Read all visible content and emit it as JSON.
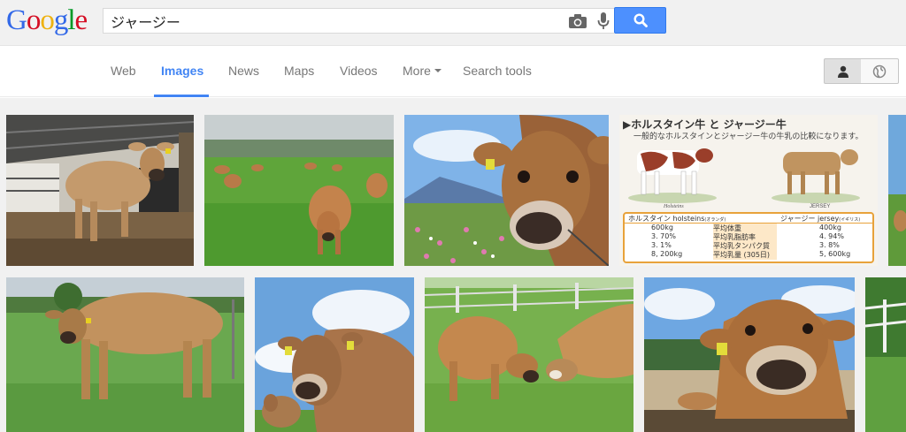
{
  "logo": {
    "letters": [
      "G",
      "o",
      "o",
      "g",
      "l",
      "e"
    ]
  },
  "search": {
    "query": "ジャージー",
    "placeholder": ""
  },
  "nav": {
    "tabs": [
      {
        "label": "Web"
      },
      {
        "label": "Images"
      },
      {
        "label": "News"
      },
      {
        "label": "Maps"
      },
      {
        "label": "Videos"
      },
      {
        "label": "More"
      },
      {
        "label": "Search tools"
      }
    ]
  },
  "icons": {
    "camera": "camera-icon",
    "mic": "microphone-icon",
    "search": "magnifier-icon",
    "person": "person-icon",
    "globe": "globe-icon"
  },
  "infographic": {
    "title": "▶ホルスタイン牛 と ジャージー牛",
    "subtitle": "一般的なホルスタインとジャージー牛の牛乳の比較になります。",
    "left_label": "Holsteins",
    "right_label": "JERSEY",
    "header_left": "ホルスタイン holsteins",
    "header_left_sub": "(オランダ)",
    "header_right": "ジャージー jersey",
    "header_right_sub": "(イギリス)",
    "rows": [
      {
        "left": "600kg",
        "metric": "平均体重",
        "right": "400kg"
      },
      {
        "left": "3. 70%",
        "metric": "平均乳脂肪率",
        "right": "4. 94%"
      },
      {
        "left": "3. 1%",
        "metric": "平均乳タンパク質",
        "right": "3. 8%"
      },
      {
        "left": "8, 200kg",
        "metric": "平均乳量 (305日)",
        "right": "5, 600kg"
      }
    ]
  },
  "colors": {
    "brand_blue": "#4285f4",
    "search_button": "#4d90fe",
    "header_bg": "#f1f1f1",
    "nav_active": "#4285f4"
  }
}
